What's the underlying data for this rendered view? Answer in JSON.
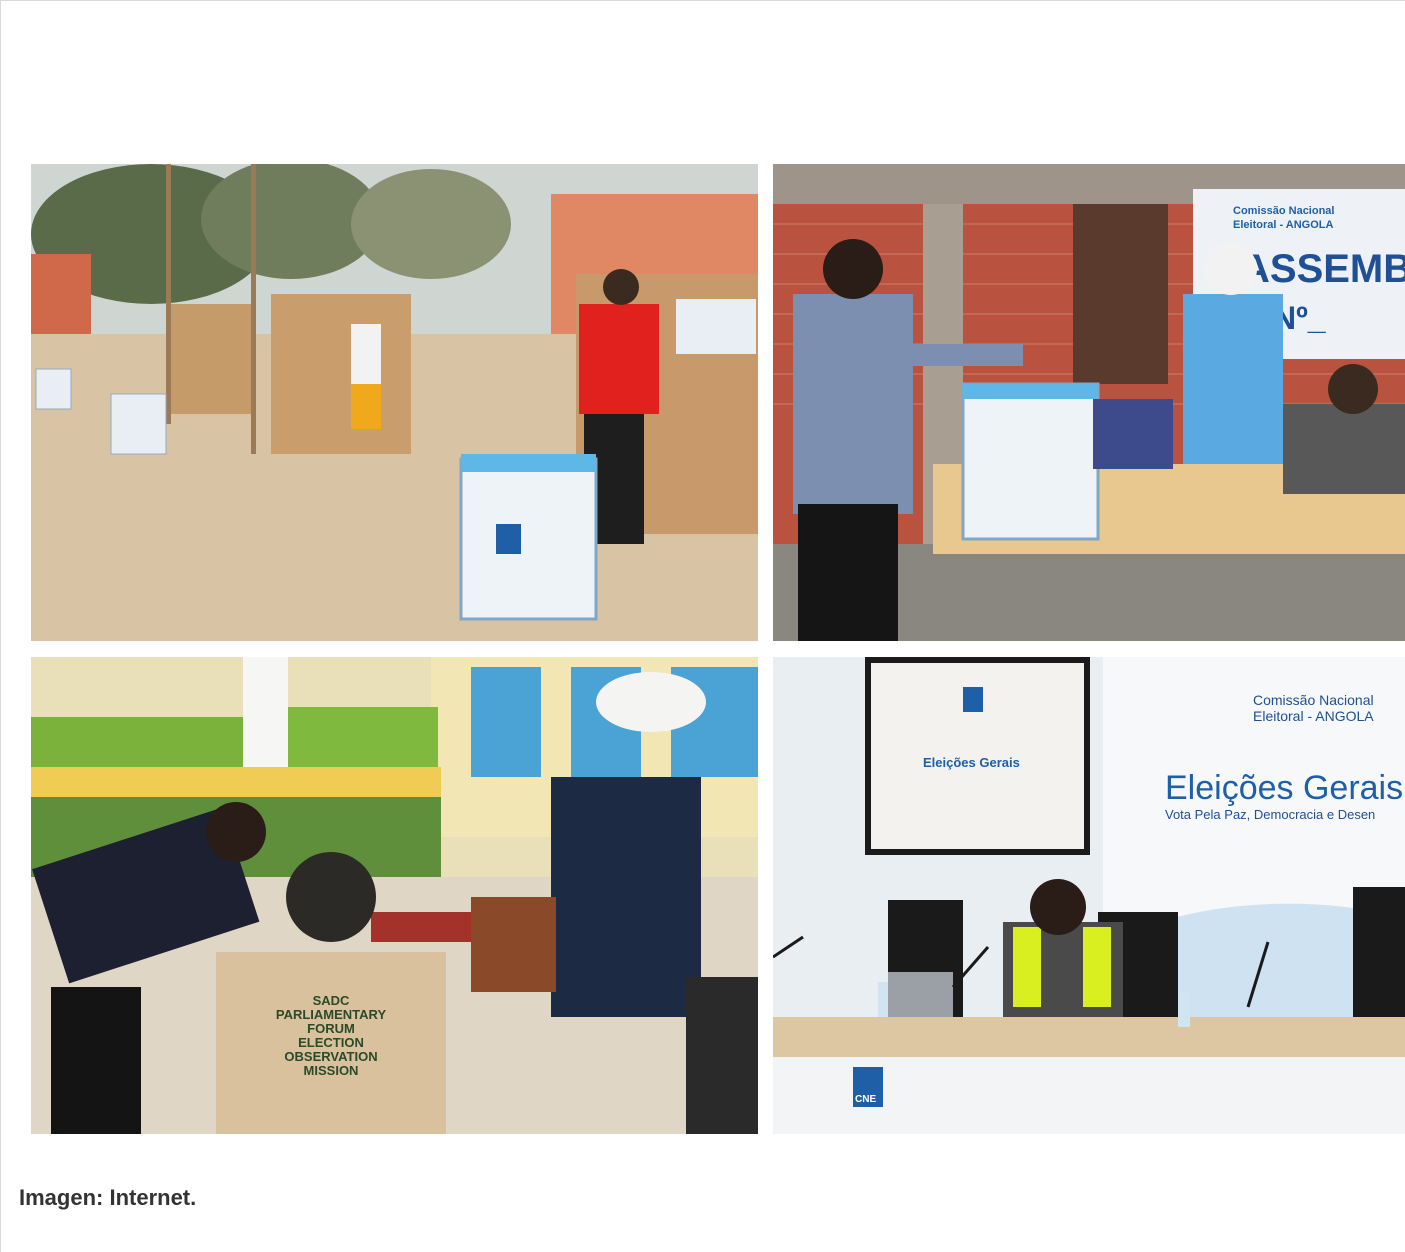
{
  "caption": "Imagen: Internet.",
  "photos": [
    {
      "id": "outdoor-polling-station"
    },
    {
      "id": "voter-casting-ballot",
      "banner_line1": "Comissão Nacional",
      "banner_line2": "Eleitoral - ANGOLA",
      "banner_big": "ASSEMBLE",
      "banner_no": "Nº_"
    },
    {
      "id": "observers-at-table",
      "vest_lines": [
        "SADC",
        "PARLIAMENTARY",
        "FORUM",
        "ELECTION",
        "OBSERVATION",
        "MISSION"
      ]
    },
    {
      "id": "press-conference",
      "wall_line1": "Comissão Nacional",
      "wall_line2": "Eleitoral - ANGOLA",
      "wall_title": "Eleições Gerais",
      "wall_slogan": "Vota Pela Paz, Democracia e Desen",
      "screen_title": "Eleições Gerais",
      "desk_logo": "CNE"
    }
  ],
  "colors": {
    "sand": "#d9c3a5",
    "brick": "#c0503a",
    "vest_blue": "#5aa9e0",
    "cne_blue": "#1f5fa8"
  }
}
